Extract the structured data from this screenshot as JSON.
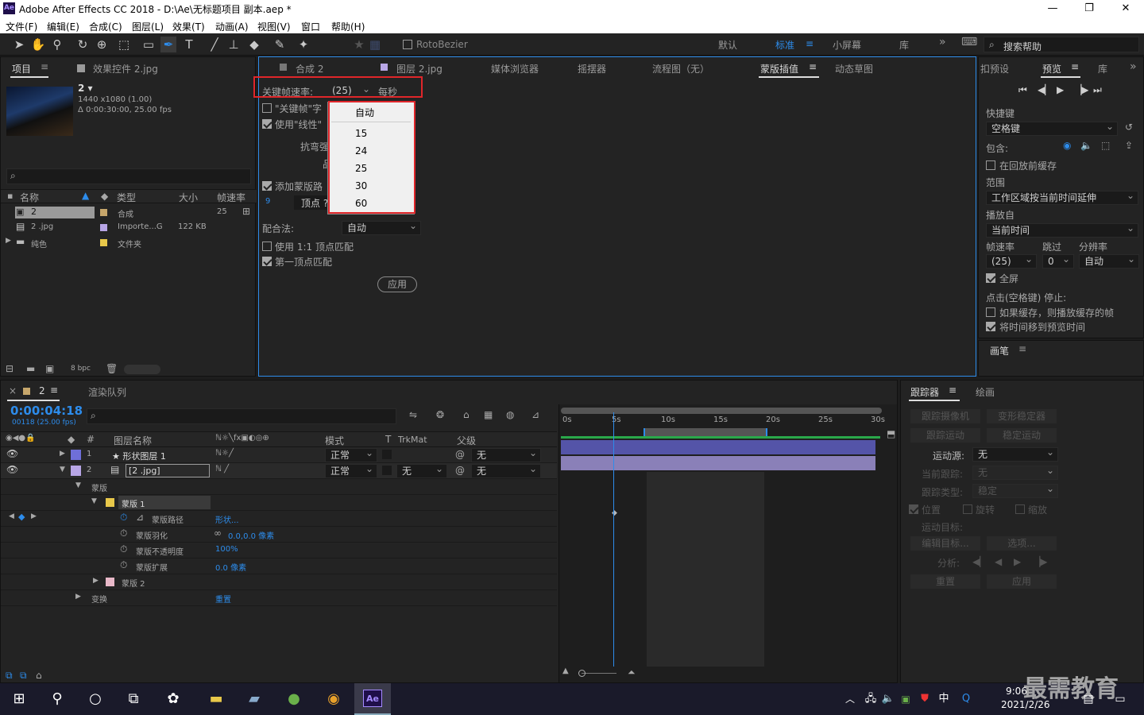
{
  "titlebar": {
    "app_icon": "Ae",
    "title": "Adobe After Effects CC 2018 - D:\\Ae\\无标题项目 副本.aep *",
    "min": "—",
    "max": "❐",
    "close": "✕"
  },
  "menu": [
    "文件(F)",
    "编辑(E)",
    "合成(C)",
    "图层(L)",
    "效果(T)",
    "动画(A)",
    "视图(V)",
    "窗口",
    "帮助(H)"
  ],
  "toolbar": {
    "rotobezier": "RotoBezier",
    "workspaces": [
      "默认",
      "标准",
      "小屏幕",
      "库"
    ],
    "search_placeholder": "搜索帮助",
    "expand": "»"
  },
  "project": {
    "tabs": [
      "项目",
      "效果控件 2.jpg"
    ],
    "comp_name": "2 ▾",
    "comp_size": "1440 x1080 (1.00)",
    "comp_duration": "Δ 0:00:30:00, 25.00 fps",
    "search_icon": "⌕",
    "columns": [
      "名称",
      "类型",
      "大小",
      "帧速率"
    ],
    "items": [
      {
        "name": "2",
        "type": "合成",
        "size": "",
        "fps": "25",
        "color": "#c6a66b"
      },
      {
        "name": "2 .jpg",
        "type": "Importe...G",
        "size": "122 KB",
        "fps": "",
        "color": "#b8a6e6"
      },
      {
        "name": "纯色",
        "type": "文件夹",
        "size": "",
        "fps": "",
        "color": "#e8c84a"
      }
    ],
    "bpc": "8 bpc"
  },
  "center": {
    "tabs": [
      "合成 2",
      "图层 2.jpg",
      "媒体浏览器",
      "摇摆器",
      "流程图（无）",
      "蒙版插值",
      "动态草图"
    ],
    "fps_label": "关键帧速率:",
    "fps_value": "(25)",
    "fps_unit": "每秒",
    "cb1": "\"关键帧\"字",
    "cb2": "使用\"线性\"",
    "label_stiff": "抗弯强",
    "label_q": "品",
    "cb_add": "添加蒙版路",
    "num9": "9",
    "label_vertex": "顶点 ?",
    "match_label": "配合法:",
    "match_value": "自动",
    "cb_11": "使用 1:1 顶点匹配",
    "cb_first": "第一顶点匹配",
    "apply": "应用",
    "dropdown": [
      "自动",
      "15",
      "24",
      "25",
      "30",
      "60"
    ]
  },
  "preview": {
    "tabs": [
      "扣预设",
      "预览",
      "库"
    ],
    "shortcut_label": "快捷键",
    "shortcut_value": "空格键",
    "include": "包含:",
    "cache_before": "在回放前缓存",
    "range_label": "范围",
    "range_value": "工作区域按当前时间延伸",
    "play_from": "播放自",
    "play_value": "当前时间",
    "fr_label": "帧速率",
    "skip_label": "跳过",
    "res_label": "分辨率",
    "fr_value": "(25)",
    "skip_value": "0",
    "res_value": "自动",
    "fullscreen": "全屏",
    "stop_label": "点击(空格键) 停止:",
    "cb_cache": "如果缓存，则播放缓存的帧",
    "cb_move": "将时间移到预览时间",
    "brush": "画笔"
  },
  "timeline": {
    "comp_tab": "2",
    "render_tab": "渲染队列",
    "timecode": "0:00:04:18",
    "timecode_sub": "00118 (25.00 fps)",
    "col_name": "图层名称",
    "col_mode": "模式",
    "col_t": "T",
    "col_trkmat": "TrkMat",
    "col_parent": "父级",
    "layers": [
      {
        "num": "1",
        "name": "★ 形状图层 1",
        "mode": "正常",
        "trk": "",
        "parent": "无",
        "color": "#6f6fd8"
      },
      {
        "num": "2",
        "name": "[2 .jpg]",
        "mode": "正常",
        "trk": "无",
        "parent": "无",
        "color": "#b8a6e6"
      }
    ],
    "props": [
      {
        "label": "蒙版",
        "val": ""
      },
      {
        "label": "蒙版 1",
        "val": ""
      },
      {
        "label": "蒙版路径",
        "val": "形状..."
      },
      {
        "label": "蒙版羽化",
        "val": "0.0,0.0 像素"
      },
      {
        "label": "蒙版不透明度",
        "val": "100%"
      },
      {
        "label": "蒙版扩展",
        "val": "0.0 像素"
      },
      {
        "label": "蒙版 2",
        "val": ""
      },
      {
        "label": "变换",
        "val": "重置"
      }
    ],
    "ruler": [
      "0s",
      "5s",
      "10s",
      "15s",
      "20s",
      "25s",
      "30s"
    ]
  },
  "tracker": {
    "tabs": [
      "跟踪器",
      "绘画"
    ],
    "btn1": "跟踪摄像机",
    "btn2": "变形稳定器",
    "btn3": "跟踪运动",
    "btn4": "稳定运动",
    "source_label": "运动源:",
    "source_value": "无",
    "current_label": "当前跟踪:",
    "current_value": "无",
    "type_label": "跟踪类型:",
    "type_value": "稳定",
    "cb_pos": "位置",
    "cb_rot": "旋转",
    "cb_scale": "缩放",
    "target_label": "运动目标:",
    "edit_target": "编辑目标...",
    "options": "选项...",
    "analyze_label": "分析:",
    "reset": "重置",
    "apply": "应用"
  },
  "taskbar": {
    "time": "9:06",
    "date": "2021/2/26",
    "lang": "中",
    "watermark": "最需教育"
  }
}
